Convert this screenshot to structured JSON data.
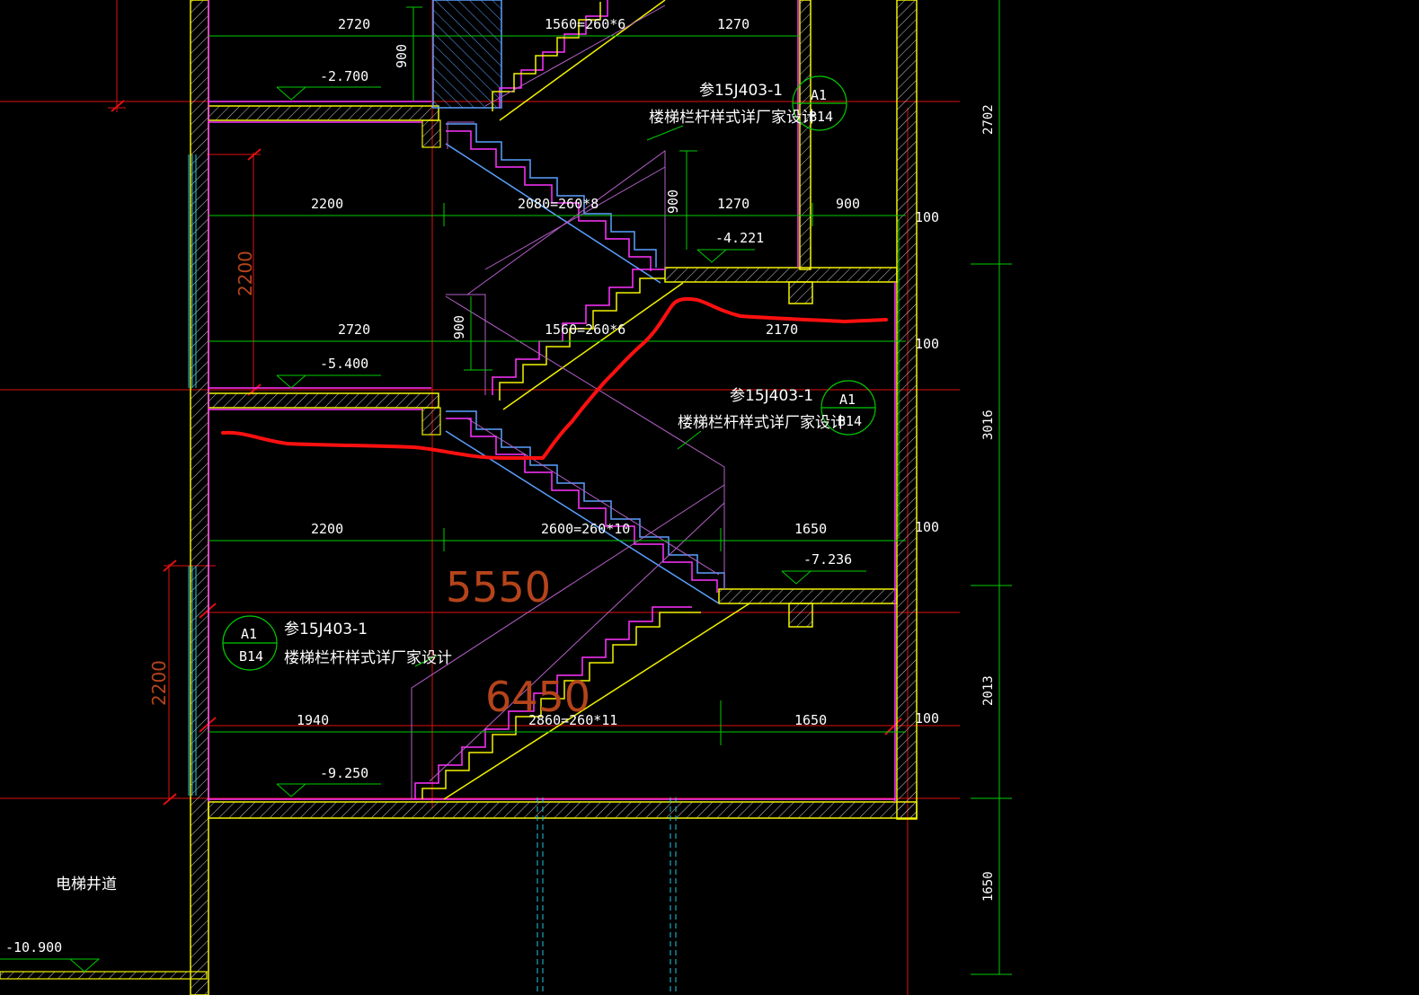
{
  "colors": {
    "background": "#000000",
    "wall": "#f2f200",
    "stair": "#ff33ff",
    "tread": "#5aa0ff",
    "dim": "#00cc00",
    "axis": "#e01010",
    "text": "#ffffff",
    "annot": "#b5441b",
    "markup": "#ff1010",
    "railing": "#cc66cc",
    "cyan": "#22c8e0"
  },
  "dimensions": {
    "top_left": "2720",
    "top_mid": "1560=260*6",
    "top_right": "1270",
    "top_vert": "900",
    "row2_left": "2200",
    "row2_mid": "2080=260*8",
    "row2_vert": "900",
    "row2_right": "1270",
    "row2_far": "900",
    "row3_left": "2720",
    "row3_vert": "900",
    "row3_mid": "1560=260*6",
    "row3_right": "2170",
    "row4_left": "2200",
    "row4_mid": "2600=260*10",
    "row4_right": "1650",
    "row5_left": "1940",
    "row5_mid": "2860=260*11",
    "row5_right": "1650",
    "left_vert_a": "2200",
    "left_vert_b": "2200",
    "side_100_a": "100",
    "side_100_b": "100",
    "side_100_c": "100",
    "side_100_d": "100",
    "right_2702": "2702",
    "right_3016": "3016",
    "right_2013": "2013",
    "right_1650": "1650"
  },
  "levels": {
    "l1": "-2.700",
    "l2": "-4.221",
    "l3": "-5.400",
    "l4": "-7.236",
    "l5": "-9.250",
    "l6": "-10.900"
  },
  "notes": {
    "ref_code": "参15J403-1",
    "railing": "楼梯栏杆样式详厂家设计",
    "bubble_top": "A1",
    "bubble_bottom": "B14"
  },
  "annotations": {
    "big_1": "5550",
    "big_2": "6450"
  },
  "labels": {
    "elevator_shaft": "电梯井道"
  }
}
